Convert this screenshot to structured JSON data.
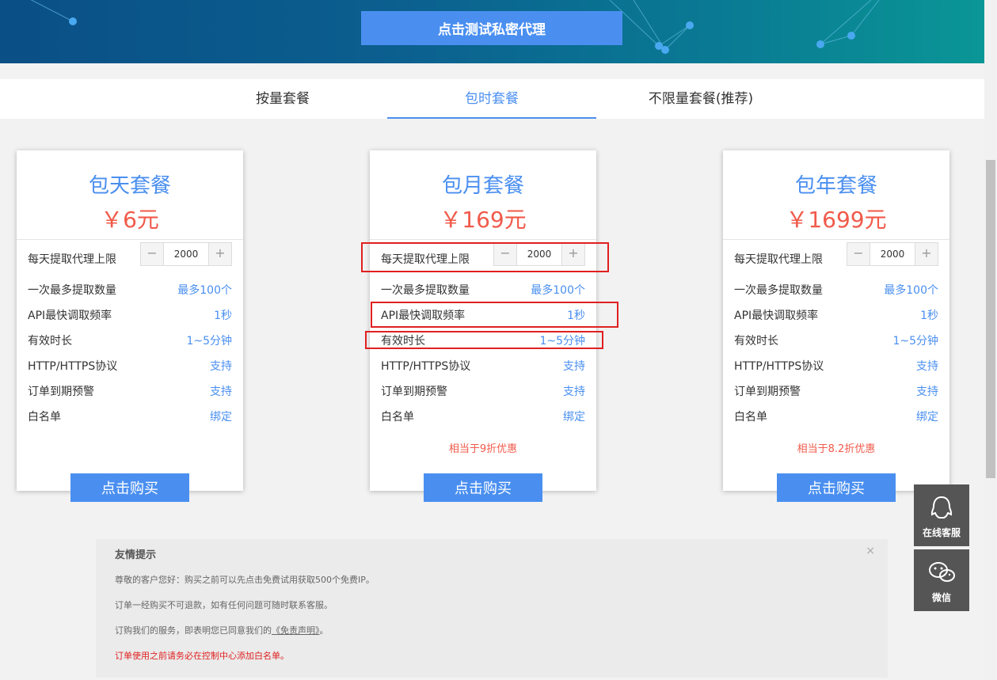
{
  "header": {
    "test_button_label": "点击测试私密代理"
  },
  "tabs": [
    {
      "label": "按量套餐",
      "active": false
    },
    {
      "label": "包时套餐",
      "active": true
    },
    {
      "label": "不限量套餐(推荐)",
      "active": false
    }
  ],
  "plans": [
    {
      "title": "包天套餐",
      "price": "￥6元",
      "stepper": {
        "label": "每天提取代理上限",
        "value": "2000",
        "minus": "−",
        "plus": "+"
      },
      "features": [
        {
          "label": "一次最多提取数量",
          "value": "最多100个"
        },
        {
          "label": "API最快调取频率",
          "value": "1秒"
        },
        {
          "label": "有效时长",
          "value": "1~5分钟"
        },
        {
          "label": "HTTP/HTTPS协议",
          "value": "支持"
        },
        {
          "label": "订单到期预警",
          "value": "支持"
        },
        {
          "label": "白名单",
          "value": "绑定"
        }
      ],
      "discount": "",
      "buy_label": "点击购买"
    },
    {
      "title": "包月套餐",
      "price": "￥169元",
      "stepper": {
        "label": "每天提取代理上限",
        "value": "2000",
        "minus": "−",
        "plus": "+"
      },
      "features": [
        {
          "label": "一次最多提取数量",
          "value": "最多100个"
        },
        {
          "label": "API最快调取频率",
          "value": "1秒"
        },
        {
          "label": "有效时长",
          "value": "1~5分钟"
        },
        {
          "label": "HTTP/HTTPS协议",
          "value": "支持"
        },
        {
          "label": "订单到期预警",
          "value": "支持"
        },
        {
          "label": "白名单",
          "value": "绑定"
        }
      ],
      "discount": "相当于9折优惠",
      "buy_label": "点击购买"
    },
    {
      "title": "包年套餐",
      "price": "￥1699元",
      "stepper": {
        "label": "每天提取代理上限",
        "value": "2000",
        "minus": "−",
        "plus": "+"
      },
      "features": [
        {
          "label": "一次最多提取数量",
          "value": "最多100个"
        },
        {
          "label": "API最快调取频率",
          "value": "1秒"
        },
        {
          "label": "有效时长",
          "value": "1~5分钟"
        },
        {
          "label": "HTTP/HTTPS协议",
          "value": "支持"
        },
        {
          "label": "订单到期预警",
          "value": "支持"
        },
        {
          "label": "白名单",
          "value": "绑定"
        }
      ],
      "discount": "相当于8.2折优惠",
      "buy_label": "点击购买"
    }
  ],
  "notice": {
    "title": "友情提示",
    "close": "×",
    "line1": "尊敬的客户您好：购买之前可以先点击免费试用获取500个免费IP。",
    "line2": "订单一经购买不可退款，如有任何问题可随时联系客服。",
    "line3_prefix": "订购我们的服务，即表明您已同意我们的",
    "line3_link": "《免责声明》",
    "line3_suffix": "。",
    "line4": "订单使用之前请务必在控制中心添加白名单。"
  },
  "side": {
    "service_label": "在线客服",
    "service_icon": "qq-icon",
    "wechat_label": "微信",
    "wechat_icon": "wechat-icon"
  },
  "colors": {
    "accent": "#4a8ff0",
    "price": "#f05a4a",
    "highlight": "#e02020"
  }
}
